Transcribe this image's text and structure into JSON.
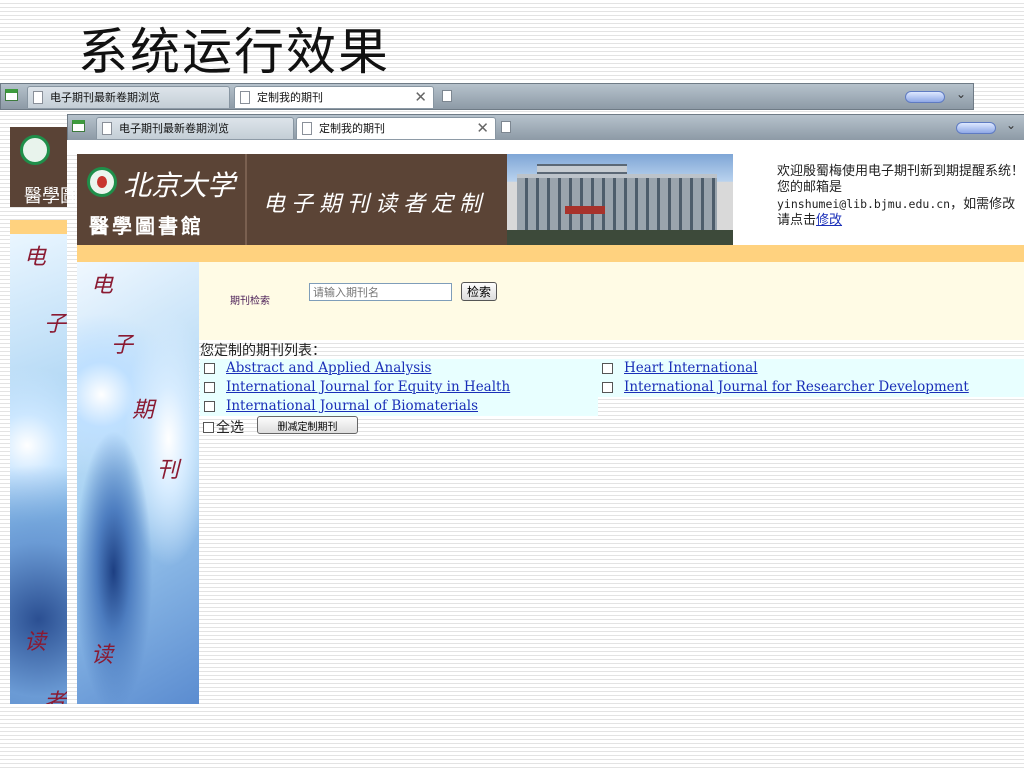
{
  "slide": {
    "title": "系统运行效果"
  },
  "browser": {
    "tabs": [
      {
        "label": "电子期刊最新卷期浏览",
        "active": false
      },
      {
        "label": "定制我的期刊",
        "active": true
      }
    ],
    "close_glyph": "✕",
    "chevron_glyph": "⌄"
  },
  "banner": {
    "university": "北京大学",
    "library": "醫學圖書館",
    "service": "电子期刊读者定制",
    "welcome_prefix": "欢迎殷蜀梅使用电子期刊新到期提醒系统！您的邮箱是",
    "email": "yinshumei@lib.bjmu.edu.cn",
    "welcome_suffix": "，如需修改请点击",
    "modify_link": "修改"
  },
  "side_banner": {
    "chars": [
      "电",
      "子",
      "期",
      "刊",
      "读",
      "者"
    ]
  },
  "search": {
    "label": "期刊检索",
    "placeholder": "请输入期刊名",
    "button": "检索"
  },
  "list": {
    "title": "您定制的期刊列表：",
    "journals": [
      "Abstract and Applied Analysis",
      "Heart International",
      "International Journal for Equity in Health",
      "International Journal for Researcher Development",
      "International Journal of Biomaterials"
    ],
    "select_all": "全选",
    "delete_button": "删减定制期刊"
  },
  "colors": {
    "banner_brown": "#5b4436",
    "accent_orange": "#ffd27f",
    "search_bg": "#fffbe5",
    "row_bg": "#e8ffff",
    "link": "#1a2fb8",
    "side_text": "#8a1a32"
  }
}
